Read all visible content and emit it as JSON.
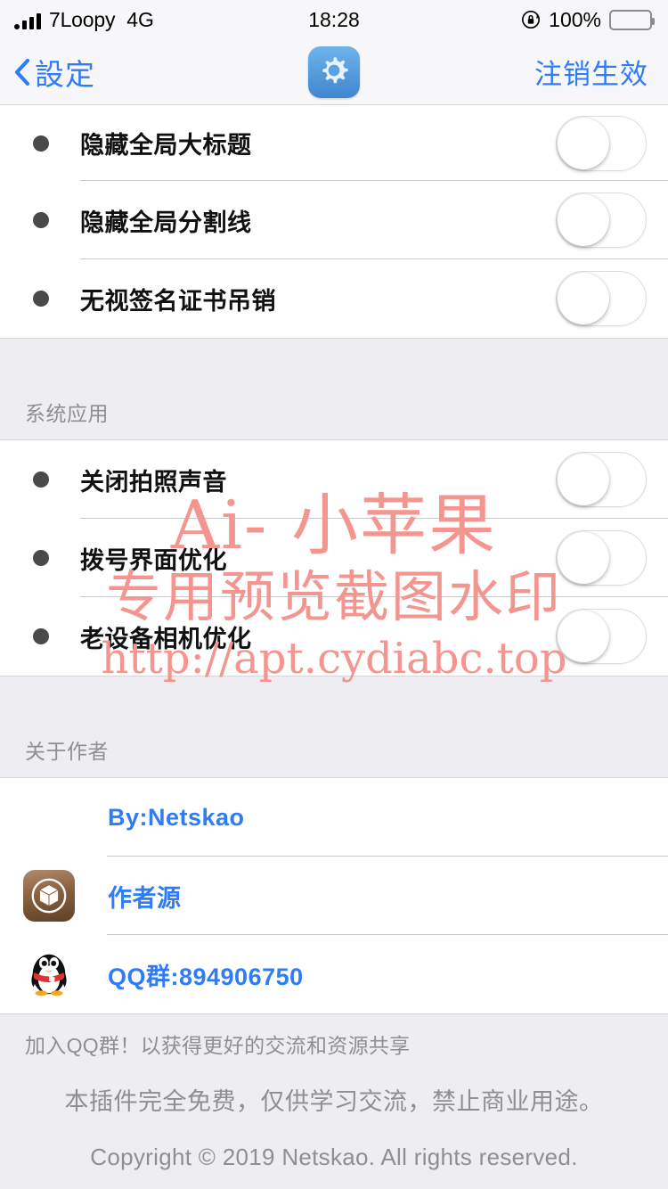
{
  "status_bar": {
    "carrier": "7Loopy",
    "network": "4G",
    "time": "18:28",
    "battery_percent": "100%",
    "signal_bars": 4,
    "rotation_lock_icon": "rotation-lock-icon",
    "battery_icon": "battery-full-icon"
  },
  "nav": {
    "back_label": "設定",
    "back_icon": "chevron-left-icon",
    "title_icon": "gear-icon",
    "right_action": "注销生效"
  },
  "groups": [
    {
      "id": "global-tweaks",
      "header": null,
      "rows": [
        {
          "label": "隐藏全局大标题",
          "toggle": "off"
        },
        {
          "label": "隐藏全局分割线",
          "toggle": "off"
        },
        {
          "label": "无视签名证书吊销",
          "toggle": "off"
        }
      ]
    },
    {
      "id": "system-apps",
      "header": "系统应用",
      "rows": [
        {
          "label": "关闭拍照声音",
          "toggle": "off"
        },
        {
          "label": "拨号界面优化",
          "toggle": "off"
        },
        {
          "label": "老设备相机优化",
          "toggle": "off"
        }
      ]
    }
  ],
  "author_section": {
    "header": "关于作者",
    "rows": [
      {
        "label": "By:Netskao",
        "icon": "author-photo-avatar"
      },
      {
        "label": "作者源",
        "icon": "cydia-icon"
      },
      {
        "label": "QQ群:894906750",
        "icon": "qq-penguin-icon"
      }
    ],
    "footer_note": "加入QQ群！以获得更好的交流和资源共享"
  },
  "tail": {
    "line1": "本插件完全免费，仅供学习交流，禁止商业用途。",
    "line2": "Copyright © 2019 Netskao. All rights reserved."
  },
  "watermark": {
    "line1": "Ai- 小苹果",
    "line2": "专用预览截图水印",
    "line3": "http://apt.cydiabc.top",
    "color": "#f4958f"
  },
  "colors": {
    "accent_blue": "#2f7cf6",
    "group_background": "#eeedf2",
    "row_background": "#ffffff",
    "label_dark": "#111111",
    "muted_gray": "#8e8e93"
  }
}
